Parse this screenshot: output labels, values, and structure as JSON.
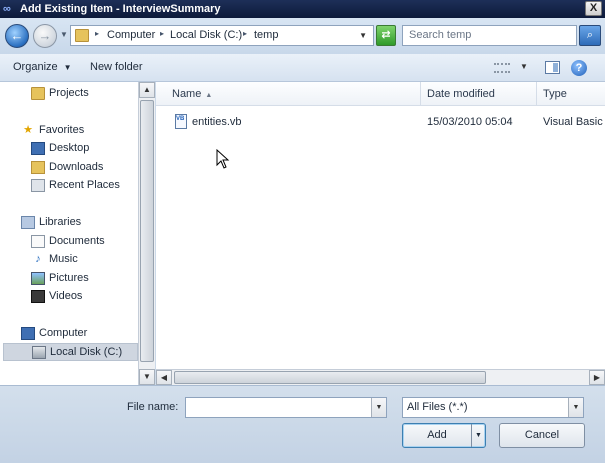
{
  "window": {
    "title": "Add Existing Item - InterviewSummary",
    "close_glyph": "X"
  },
  "address_bar": {
    "breadcrumbs": [
      "Computer",
      "Local Disk (C:)",
      "temp"
    ],
    "search_placeholder": "Search temp"
  },
  "toolbar": {
    "organize_label": "Organize",
    "new_folder_label": "New folder"
  },
  "nav_pane": {
    "items": [
      {
        "label": "Projects",
        "icon": "folder-icon"
      },
      {
        "label": "Favorites",
        "icon": "star-icon"
      },
      {
        "label": "Desktop",
        "icon": "desktop-icon"
      },
      {
        "label": "Downloads",
        "icon": "downloads-icon"
      },
      {
        "label": "Recent Places",
        "icon": "recent-places-icon"
      },
      {
        "label": "Libraries",
        "icon": "libraries-icon"
      },
      {
        "label": "Documents",
        "icon": "documents-icon"
      },
      {
        "label": "Music",
        "icon": "music-icon"
      },
      {
        "label": "Pictures",
        "icon": "pictures-icon"
      },
      {
        "label": "Videos",
        "icon": "videos-icon"
      },
      {
        "label": "Computer",
        "icon": "computer-icon"
      },
      {
        "label": "Local Disk (C:)",
        "icon": "disk-icon"
      }
    ],
    "selected": "Local Disk (C:)"
  },
  "file_list": {
    "columns": [
      "Name",
      "Date modified",
      "Type"
    ],
    "rows": [
      {
        "name": "entities.vb",
        "date_modified": "15/03/2010 05:04",
        "type": "Visual Basic S"
      }
    ]
  },
  "bottom": {
    "file_name_label": "File name:",
    "file_name_value": "",
    "filter_value": "All Files (*.*)",
    "add_label": "Add",
    "cancel_label": "Cancel"
  }
}
